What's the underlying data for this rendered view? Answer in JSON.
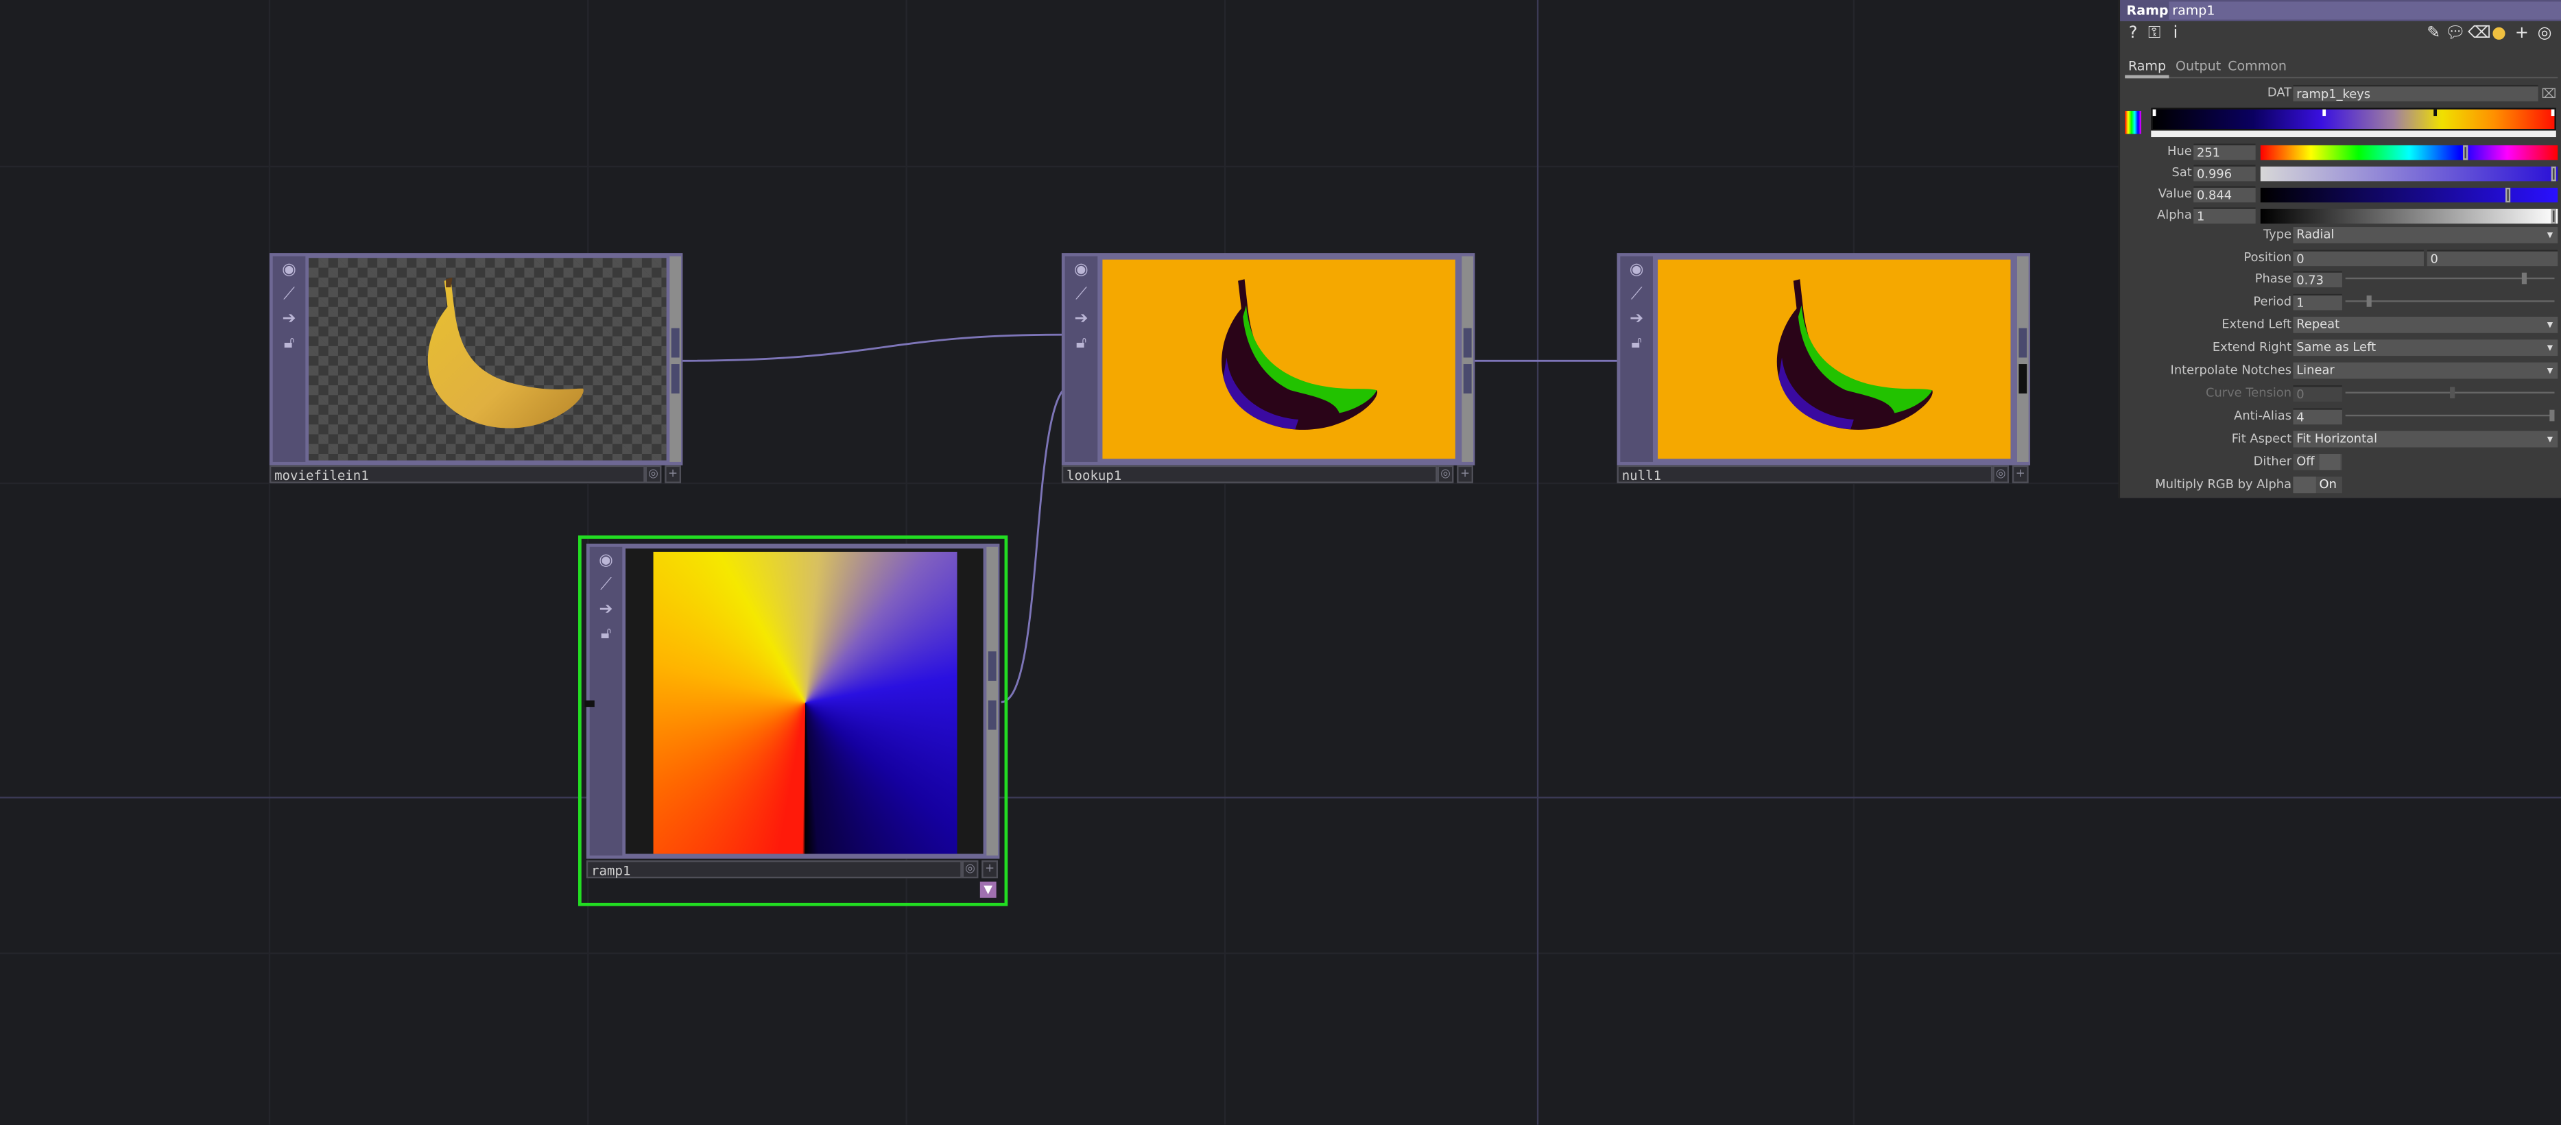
{
  "nodes": {
    "moviefilein": {
      "name": "moviefilein1"
    },
    "lookup": {
      "name": "lookup1"
    },
    "null": {
      "name": "null1"
    },
    "ramp": {
      "name": "ramp1"
    }
  },
  "panel": {
    "op_type": "Ramp",
    "op_name": "ramp1",
    "tabs": [
      "Ramp",
      "Output",
      "Common"
    ],
    "active_tab": "Ramp",
    "dat": {
      "label": "DAT",
      "value": "ramp1_keys"
    },
    "hue": {
      "label": "Hue",
      "value": "251"
    },
    "sat": {
      "label": "Sat",
      "value": "0.996"
    },
    "val": {
      "label": "Value",
      "value": "0.844"
    },
    "alpha": {
      "label": "Alpha",
      "value": "1"
    },
    "type": {
      "label": "Type",
      "value": "Radial"
    },
    "position": {
      "label": "Position",
      "x": "0",
      "y": "0"
    },
    "phase": {
      "label": "Phase",
      "value": "0.73"
    },
    "period": {
      "label": "Period",
      "value": "1"
    },
    "extend_left": {
      "label": "Extend Left",
      "value": "Repeat"
    },
    "extend_right": {
      "label": "Extend Right",
      "value": "Same as Left"
    },
    "interpolate": {
      "label": "Interpolate Notches",
      "value": "Linear"
    },
    "curve_tension": {
      "label": "Curve Tension",
      "value": "0"
    },
    "anti_alias": {
      "label": "Anti-Alias",
      "value": "4"
    },
    "fit_aspect": {
      "label": "Fit Aspect",
      "value": "Fit Horizontal"
    },
    "dither": {
      "label": "Dither",
      "value": "Off"
    },
    "multiply": {
      "label": "Multiply RGB by Alpha",
      "value": "On"
    }
  },
  "colors": {
    "background": "#1c1d21",
    "node_frame": "#6e6894",
    "selected_outline": "#22dd22",
    "wire": "#7d75b8",
    "lookup_bg": "#f5a800"
  }
}
